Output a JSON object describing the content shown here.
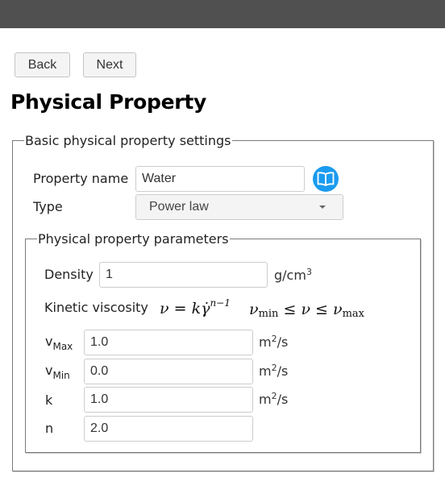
{
  "nav": {
    "back_label": "Back",
    "next_label": "Next"
  },
  "page": {
    "title": "Physical Property"
  },
  "basic": {
    "legend": "Basic physical property settings",
    "property_name_label": "Property name",
    "property_name_value": "Water",
    "type_label": "Type",
    "type_value": "Power law",
    "icon": "book-icon",
    "icon_color": "#1a9bf0"
  },
  "params": {
    "legend": "Physical property parameters",
    "density": {
      "label": "Density",
      "value": "1",
      "unit_base": "g/cm",
      "unit_exp": "3"
    },
    "kinetic_viscosity": {
      "label": "Kinetic viscosity",
      "formula": {
        "lhs": "ν",
        "eq": "=",
        "k": "k",
        "gamma": "γ̇",
        "exp": "n−1"
      },
      "constraint": {
        "nu": "ν",
        "min": "min",
        "max": "max",
        "le": "≤"
      }
    },
    "rows": [
      {
        "label": "v",
        "sub": "Max",
        "value": "1.0",
        "unit_base": "m",
        "unit_exp": "2",
        "unit_tail": "/s"
      },
      {
        "label": "v",
        "sub": "Min",
        "value": "0.0",
        "unit_base": "m",
        "unit_exp": "2",
        "unit_tail": "/s"
      },
      {
        "label": "k",
        "sub": "",
        "value": "1.0",
        "unit_base": "m",
        "unit_exp": "2",
        "unit_tail": "/s"
      },
      {
        "label": "n",
        "sub": "",
        "value": "2.0"
      }
    ]
  }
}
